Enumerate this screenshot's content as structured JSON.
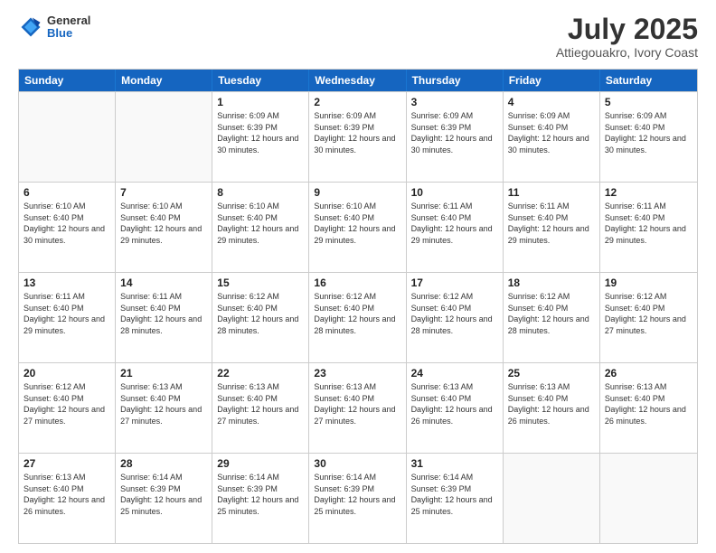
{
  "header": {
    "logo": {
      "general": "General",
      "blue": "Blue"
    },
    "title": "July 2025",
    "location": "Attiegouakro, Ivory Coast"
  },
  "calendar": {
    "days_of_week": [
      "Sunday",
      "Monday",
      "Tuesday",
      "Wednesday",
      "Thursday",
      "Friday",
      "Saturday"
    ],
    "weeks": [
      [
        {
          "day": "",
          "info": ""
        },
        {
          "day": "",
          "info": ""
        },
        {
          "day": "1",
          "info": "Sunrise: 6:09 AM\nSunset: 6:39 PM\nDaylight: 12 hours and 30 minutes."
        },
        {
          "day": "2",
          "info": "Sunrise: 6:09 AM\nSunset: 6:39 PM\nDaylight: 12 hours and 30 minutes."
        },
        {
          "day": "3",
          "info": "Sunrise: 6:09 AM\nSunset: 6:39 PM\nDaylight: 12 hours and 30 minutes."
        },
        {
          "day": "4",
          "info": "Sunrise: 6:09 AM\nSunset: 6:40 PM\nDaylight: 12 hours and 30 minutes."
        },
        {
          "day": "5",
          "info": "Sunrise: 6:09 AM\nSunset: 6:40 PM\nDaylight: 12 hours and 30 minutes."
        }
      ],
      [
        {
          "day": "6",
          "info": "Sunrise: 6:10 AM\nSunset: 6:40 PM\nDaylight: 12 hours and 30 minutes."
        },
        {
          "day": "7",
          "info": "Sunrise: 6:10 AM\nSunset: 6:40 PM\nDaylight: 12 hours and 29 minutes."
        },
        {
          "day": "8",
          "info": "Sunrise: 6:10 AM\nSunset: 6:40 PM\nDaylight: 12 hours and 29 minutes."
        },
        {
          "day": "9",
          "info": "Sunrise: 6:10 AM\nSunset: 6:40 PM\nDaylight: 12 hours and 29 minutes."
        },
        {
          "day": "10",
          "info": "Sunrise: 6:11 AM\nSunset: 6:40 PM\nDaylight: 12 hours and 29 minutes."
        },
        {
          "day": "11",
          "info": "Sunrise: 6:11 AM\nSunset: 6:40 PM\nDaylight: 12 hours and 29 minutes."
        },
        {
          "day": "12",
          "info": "Sunrise: 6:11 AM\nSunset: 6:40 PM\nDaylight: 12 hours and 29 minutes."
        }
      ],
      [
        {
          "day": "13",
          "info": "Sunrise: 6:11 AM\nSunset: 6:40 PM\nDaylight: 12 hours and 29 minutes."
        },
        {
          "day": "14",
          "info": "Sunrise: 6:11 AM\nSunset: 6:40 PM\nDaylight: 12 hours and 28 minutes."
        },
        {
          "day": "15",
          "info": "Sunrise: 6:12 AM\nSunset: 6:40 PM\nDaylight: 12 hours and 28 minutes."
        },
        {
          "day": "16",
          "info": "Sunrise: 6:12 AM\nSunset: 6:40 PM\nDaylight: 12 hours and 28 minutes."
        },
        {
          "day": "17",
          "info": "Sunrise: 6:12 AM\nSunset: 6:40 PM\nDaylight: 12 hours and 28 minutes."
        },
        {
          "day": "18",
          "info": "Sunrise: 6:12 AM\nSunset: 6:40 PM\nDaylight: 12 hours and 28 minutes."
        },
        {
          "day": "19",
          "info": "Sunrise: 6:12 AM\nSunset: 6:40 PM\nDaylight: 12 hours and 27 minutes."
        }
      ],
      [
        {
          "day": "20",
          "info": "Sunrise: 6:12 AM\nSunset: 6:40 PM\nDaylight: 12 hours and 27 minutes."
        },
        {
          "day": "21",
          "info": "Sunrise: 6:13 AM\nSunset: 6:40 PM\nDaylight: 12 hours and 27 minutes."
        },
        {
          "day": "22",
          "info": "Sunrise: 6:13 AM\nSunset: 6:40 PM\nDaylight: 12 hours and 27 minutes."
        },
        {
          "day": "23",
          "info": "Sunrise: 6:13 AM\nSunset: 6:40 PM\nDaylight: 12 hours and 27 minutes."
        },
        {
          "day": "24",
          "info": "Sunrise: 6:13 AM\nSunset: 6:40 PM\nDaylight: 12 hours and 26 minutes."
        },
        {
          "day": "25",
          "info": "Sunrise: 6:13 AM\nSunset: 6:40 PM\nDaylight: 12 hours and 26 minutes."
        },
        {
          "day": "26",
          "info": "Sunrise: 6:13 AM\nSunset: 6:40 PM\nDaylight: 12 hours and 26 minutes."
        }
      ],
      [
        {
          "day": "27",
          "info": "Sunrise: 6:13 AM\nSunset: 6:40 PM\nDaylight: 12 hours and 26 minutes."
        },
        {
          "day": "28",
          "info": "Sunrise: 6:14 AM\nSunset: 6:39 PM\nDaylight: 12 hours and 25 minutes."
        },
        {
          "day": "29",
          "info": "Sunrise: 6:14 AM\nSunset: 6:39 PM\nDaylight: 12 hours and 25 minutes."
        },
        {
          "day": "30",
          "info": "Sunrise: 6:14 AM\nSunset: 6:39 PM\nDaylight: 12 hours and 25 minutes."
        },
        {
          "day": "31",
          "info": "Sunrise: 6:14 AM\nSunset: 6:39 PM\nDaylight: 12 hours and 25 minutes."
        },
        {
          "day": "",
          "info": ""
        },
        {
          "day": "",
          "info": ""
        }
      ]
    ]
  }
}
